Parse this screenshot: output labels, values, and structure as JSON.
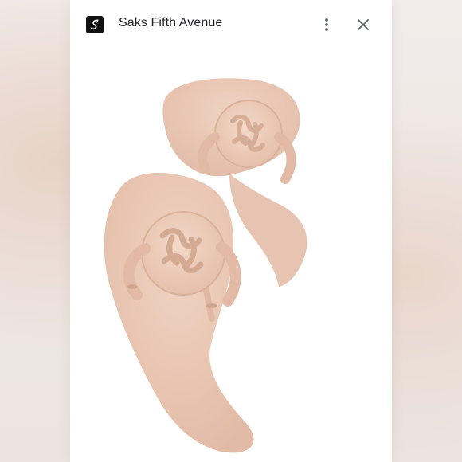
{
  "header": {
    "source_name": "Saks Fifth Avenue",
    "logo_icon": "saks-logo-icon",
    "more_icon": "more-vert-icon",
    "close_icon": "close-icon"
  },
  "image": {
    "subject_icon": "sandal-pair-image",
    "colors": {
      "leather": "#eccbb8",
      "leather_shadow": "#d9b19b",
      "background": "#ffffff"
    }
  }
}
